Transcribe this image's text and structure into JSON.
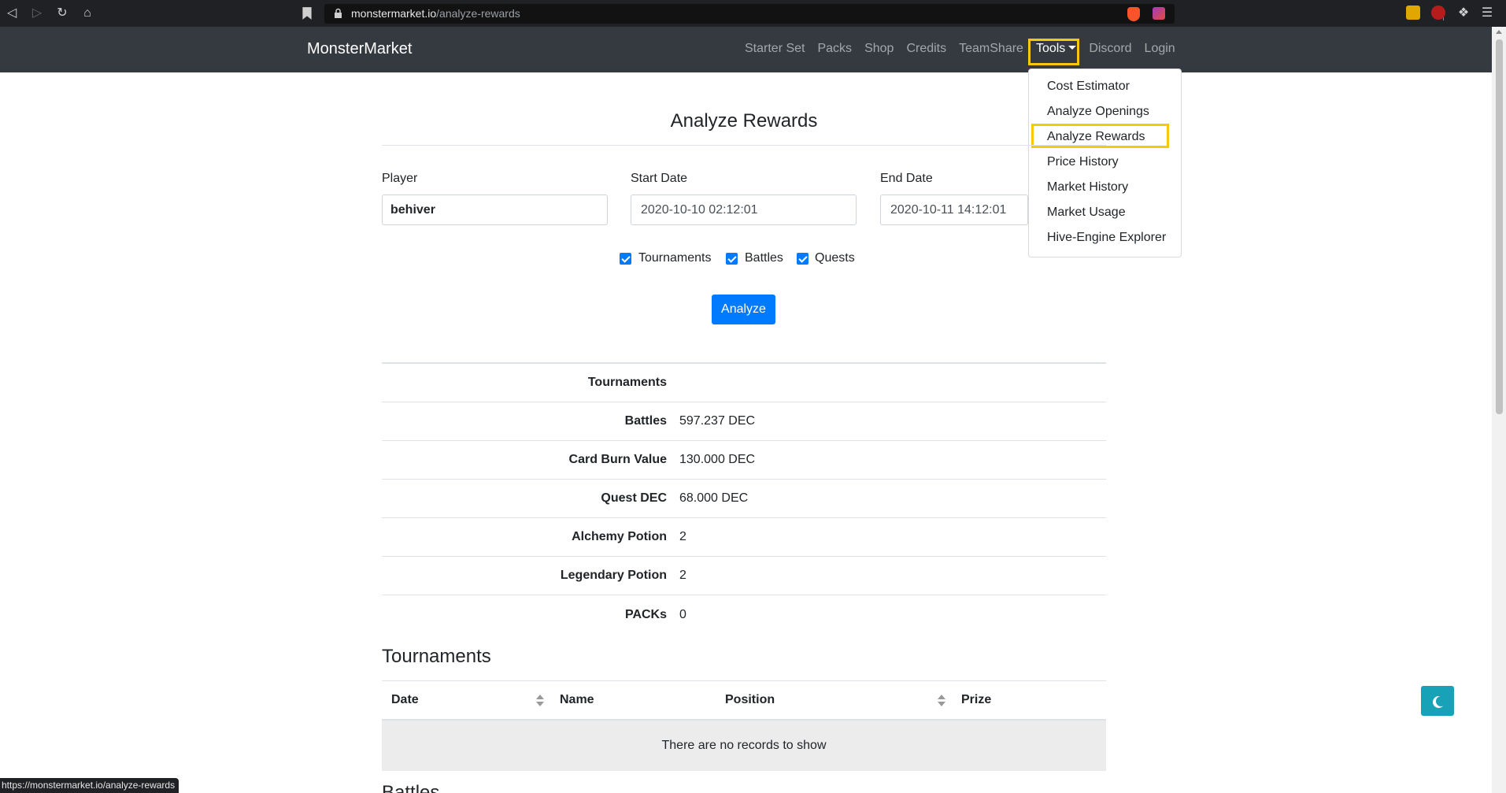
{
  "browser": {
    "url_domain": "monstermarket.io",
    "url_path": "/analyze-rewards"
  },
  "navbar": {
    "brand": "MonsterMarket",
    "links": [
      "Starter Set",
      "Packs",
      "Shop",
      "Credits",
      "TeamShare"
    ],
    "tools_label": "Tools",
    "links_after": [
      "Discord",
      "Login"
    ]
  },
  "tools_menu": {
    "items": [
      "Cost Estimator",
      "Analyze Openings",
      "Analyze Rewards",
      "Price History",
      "Market History",
      "Market Usage",
      "Hive-Engine Explorer"
    ],
    "highlighted": "Analyze Rewards"
  },
  "form": {
    "title": "Analyze Rewards",
    "player_label": "Player",
    "player_value": "behiver",
    "start_label": "Start Date",
    "start_value": "2020-10-10 02:12:01",
    "end_label": "End Date",
    "end_value": "2020-10-11 14:12:01",
    "checkboxes": [
      {
        "label": "Tournaments",
        "checked": true
      },
      {
        "label": "Battles",
        "checked": true
      },
      {
        "label": "Quests",
        "checked": true
      }
    ],
    "submit_label": "Analyze"
  },
  "summary": [
    {
      "key": "Tournaments",
      "value": ""
    },
    {
      "key": "Battles",
      "value": "597.237 DEC"
    },
    {
      "key": "Card Burn Value",
      "value": "130.000 DEC"
    },
    {
      "key": "Quest DEC",
      "value": "68.000 DEC"
    },
    {
      "key": "Alchemy Potion",
      "value": "2"
    },
    {
      "key": "Legendary Potion",
      "value": "2"
    },
    {
      "key": "PACKs",
      "value": "0"
    }
  ],
  "tournaments": {
    "heading": "Tournaments",
    "columns": [
      "Date",
      "Name",
      "Position",
      "Prize"
    ],
    "empty_text": "There are no records to show"
  },
  "battles": {
    "heading": "Battles"
  },
  "status_bar": "https://monstermarket.io/analyze-rewards",
  "colors": {
    "navbar": "#343a40",
    "primary": "#007bff",
    "highlight": "#f6c90e",
    "theme_button": "#17a2b8"
  }
}
